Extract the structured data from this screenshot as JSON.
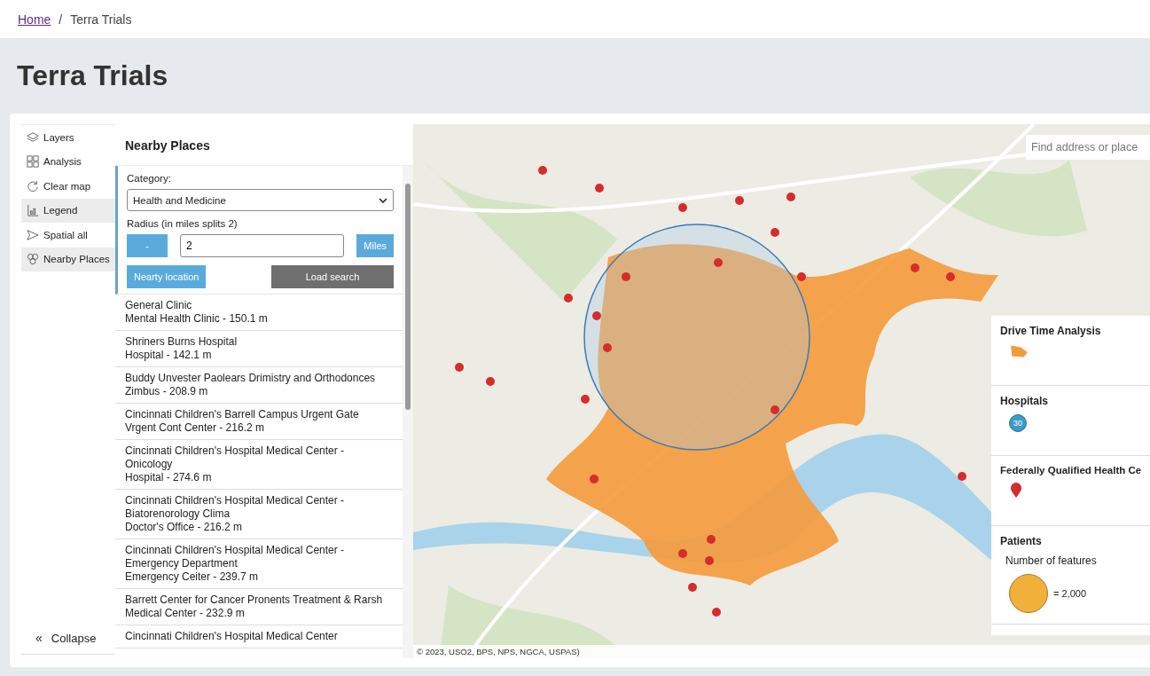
{
  "breadcrumb": {
    "items": [
      {
        "label": "Home",
        "kind": "link"
      },
      {
        "label": "Terra Trials",
        "kind": "current"
      }
    ],
    "separator": "/"
  },
  "page_title": "Terra Trials",
  "sidebar": {
    "items": [
      {
        "label": "Layers",
        "selected": false
      },
      {
        "label": "Analysis",
        "selected": false
      },
      {
        "label": "Clear map",
        "selected": false
      },
      {
        "label": "Legend",
        "selected": true
      },
      {
        "label": "Spatial all",
        "selected": false
      },
      {
        "label": "Nearby Places",
        "selected": true
      }
    ],
    "collapse": {
      "icon": "«",
      "label": "Collapse"
    }
  },
  "panel": {
    "title": "Nearby Places",
    "category_label": "Category:",
    "category_value": "Health and Medicine",
    "radius_label": "Radius (in miles splits 2)",
    "minus_button": "-",
    "radius_value": "2",
    "unit_button": "Miles",
    "nearby_button": "Nearty location",
    "load_button": "Load search",
    "results": [
      {
        "name": "General Clinic",
        "detail": "Mental Health Clinic - 150.1 m"
      },
      {
        "name": "Shriners Burns Hospital",
        "detail": "Hospital - 142.1 m"
      },
      {
        "name": "Buddy Unvester Paolears Drimistry and Orthodonces",
        "detail": "Zimbus - 208.9 m"
      },
      {
        "name": "Cincinnati Children's Barrell Campus Urgent Gate",
        "detail": "Vrgent Cont Center - 216.2 m"
      },
      {
        "name": "Cincinnati Children's Hospital Medical Center - Onicology",
        "detail": "Hospital - 274.6 m"
      },
      {
        "name": "Cincinnati Children's Hospital Medical Center - Biatorenorology Clima",
        "detail": "Doctor's Office - 216.2 m"
      },
      {
        "name": "Cincinnati Children's Hospital Medical Center - Emergency Department",
        "detail": "Emergency Ceiter - 239.7 m"
      },
      {
        "name": "Barrett Center for Cancer Pronents Treatment & Rarsh",
        "detail": "Medical Center - 232.9 m"
      },
      {
        "name": "Cincinnati Children's Hospital Medical Center"
      }
    ]
  },
  "map": {
    "search_placeholder": "Find address or place",
    "attribution": "© 2023, USO2, BPS, NPS, NGCA, USPAS)",
    "legend": [
      {
        "title": "Drive Time Analysis",
        "kind": "area"
      },
      {
        "title": "Hospitals",
        "kind": "cluster",
        "count": "30"
      },
      {
        "title": "Federally Qualified Health Ce",
        "kind": "pin"
      },
      {
        "title": "Patients",
        "kind": "size",
        "subtitle": "Number of features",
        "value": "= 2,000"
      }
    ]
  }
}
